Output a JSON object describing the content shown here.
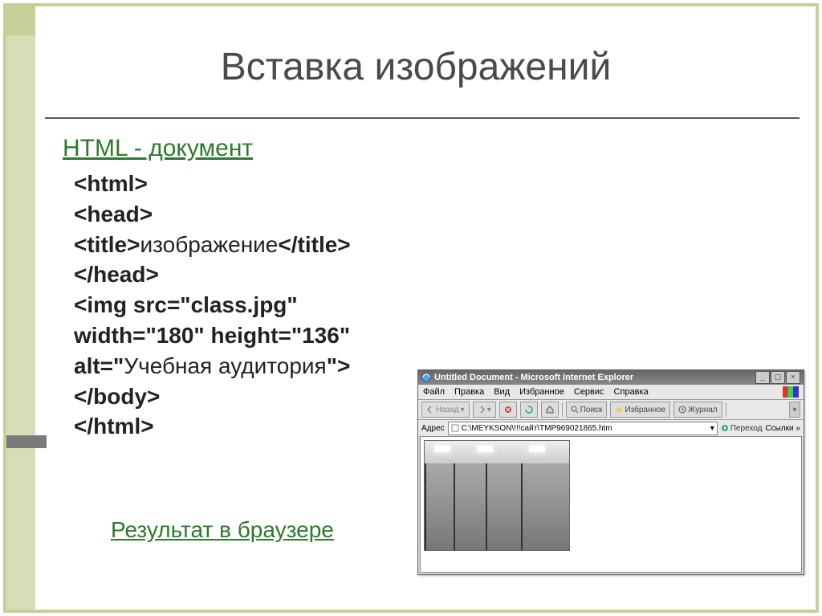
{
  "title": "Вставка изображений",
  "link_html_doc": "HTML - документ",
  "link_result": "Результат в браузере",
  "code": {
    "l1": "<html>",
    "l2": "<head>",
    "l3a": "<title>",
    "l3b": "изображение",
    "l3c": "</title>",
    "l4": "</head>",
    "l5": "<img src=\"class.jpg\"",
    "l6": "width=\"180\" height=\"136\"",
    "l7a": "alt=\"",
    "l7b": "Учебная аудитория",
    "l7c": "\">",
    "l8": "</body>",
    "l9": "</html>"
  },
  "browser": {
    "title": "Untitled Document - Microsoft Internet Explorer",
    "menu": [
      "Файл",
      "Правка",
      "Вид",
      "Избранное",
      "Сервис",
      "Справка"
    ],
    "tool": {
      "back": "Назад",
      "search": "Поиск",
      "favorites": "Избранное",
      "history": "Журнал"
    },
    "address_label": "Адрес",
    "address_value": "C:\\MEYKSON\\!!!сайт\\TMP969021865.htm",
    "go_label": "Переход",
    "links_label": "Ссылки"
  }
}
